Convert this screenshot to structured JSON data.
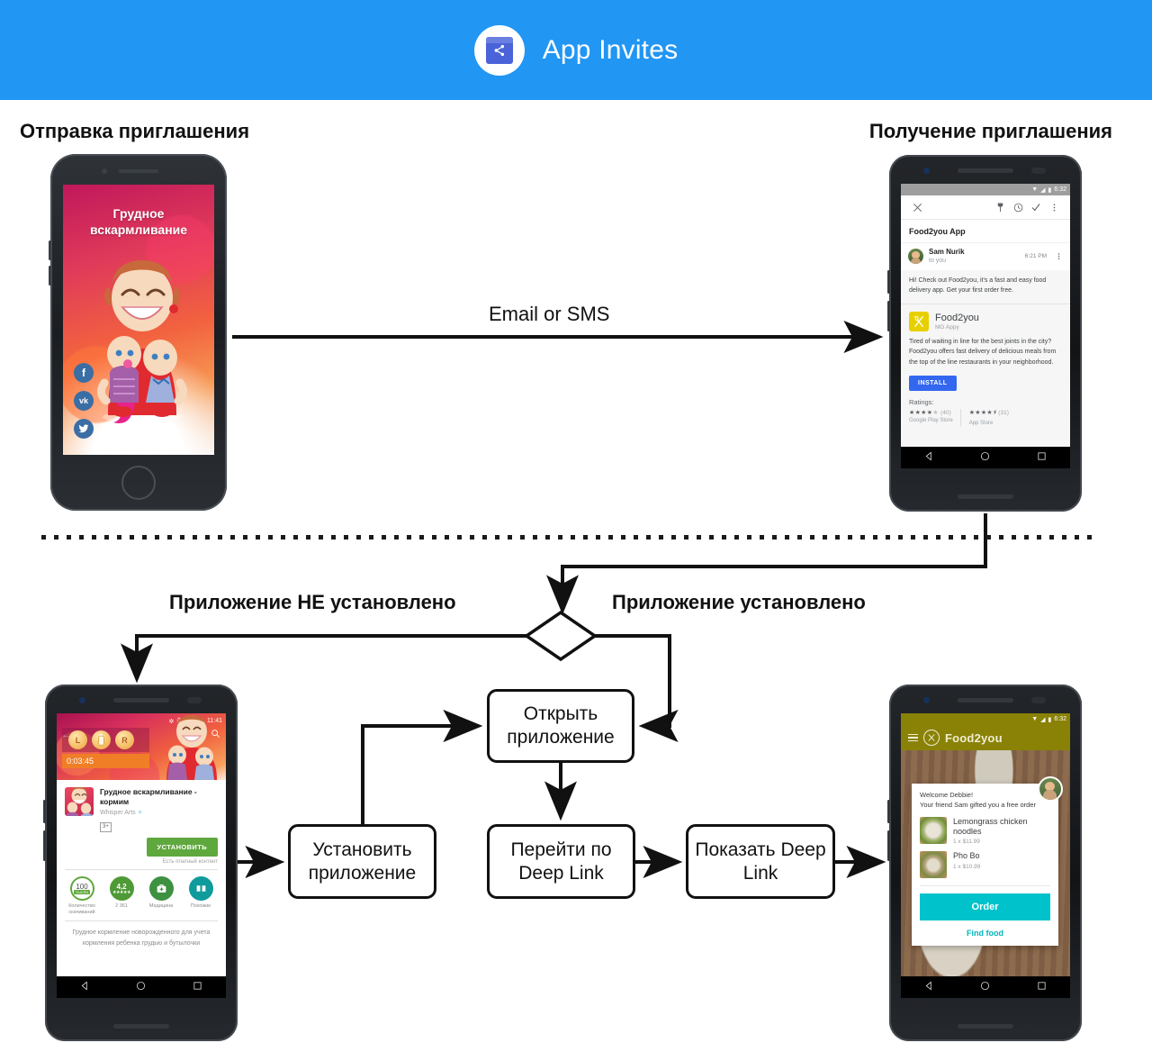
{
  "header": {
    "title": "App Invites",
    "icon": "share-icon",
    "bg_color": "#2196f3"
  },
  "sections": {
    "send_heading": "Отправка приглашения",
    "receive_heading": "Получение приглашения"
  },
  "flow": {
    "email_or_sms_label": "Email or SMS",
    "not_installed_label": "Приложение НЕ установлено",
    "installed_label": "Приложение установлено",
    "boxes": {
      "open_app": "Открыть приложение",
      "install_app": "Установить приложение",
      "go_deeplink": "Перейти по Deep Link",
      "show_deeplink": "Показать Deep Link"
    }
  },
  "phone_send": {
    "app_title": "Грудное вскармливание",
    "social": [
      {
        "name": "facebook",
        "glyph": "f"
      },
      {
        "name": "vk",
        "glyph": "vk"
      },
      {
        "name": "twitter",
        "glyph": "🐦"
      }
    ]
  },
  "phone_gmail": {
    "status_time": "6:32",
    "toolbar_icons": [
      "close-icon",
      "pin-icon",
      "snooze-icon",
      "check-icon",
      "overflow-icon"
    ],
    "subject": "Food2you App",
    "sender_name": "Sam Nurik",
    "sender_to": "to you",
    "sender_time": "6:21 PM",
    "message": "Hi! Check out Food2you, it's a fast and easy food delivery app. Get your first order free.",
    "app_name": "Food2you",
    "app_developer": "MG Appy",
    "app_description": "Tired of waiting in line for the best joints in the city? Food2you offers fast delivery of delicious meals from the top of the line restaurants in your neighborhood.",
    "install_button": "INSTALL",
    "ratings_label": "Ratings:",
    "ratings": [
      {
        "stars": "★★★★",
        "dim_stars": "★",
        "count": "(40)",
        "store": "Google Play Store"
      },
      {
        "stars": "★★★★",
        "dim_stars": "⯨",
        "count": "(31)",
        "store": "App Store"
      }
    ]
  },
  "phone_store": {
    "status_time": "11:41",
    "timer": "0:03:45",
    "hero_buttons": [
      "L",
      "",
      "R"
    ],
    "app_name": "Грудное вскармливание - кормим",
    "developer": "Whisper Arts",
    "age_rating": "3+",
    "install_button": "УСТАНОВИТЬ",
    "paid_content": "Есть платный контент",
    "stats": [
      {
        "value": "100",
        "sub": "ТЫСЯЧ",
        "label": "Количество скачиваний"
      },
      {
        "value": "4,2",
        "sub": "★★★★★",
        "label": "2 361"
      },
      {
        "value": "",
        "sub": "",
        "label": "Медицина",
        "icon": "medical-bag-icon"
      },
      {
        "value": "",
        "sub": "",
        "label": "Похожие",
        "icon": "similar-apps-icon"
      }
    ],
    "description": "Грудное кормление новорожденного для учета кормления ребенка грудью и бутылочки"
  },
  "phone_food": {
    "status_time": "6:32",
    "brand": "Food2you",
    "welcome_line1": "Welcome Debbie!",
    "welcome_line2": "Your friend Sam gifted you a free order",
    "items": [
      {
        "name": "Lemongrass chicken noodles",
        "price": "1 x $11.99"
      },
      {
        "name": "Pho Bo",
        "price": "1 x $10.99"
      }
    ],
    "order_button": "Order",
    "find_food_link": "Find food",
    "accent_color": "#00c2cb",
    "toolbar_color": "#8a8207"
  }
}
